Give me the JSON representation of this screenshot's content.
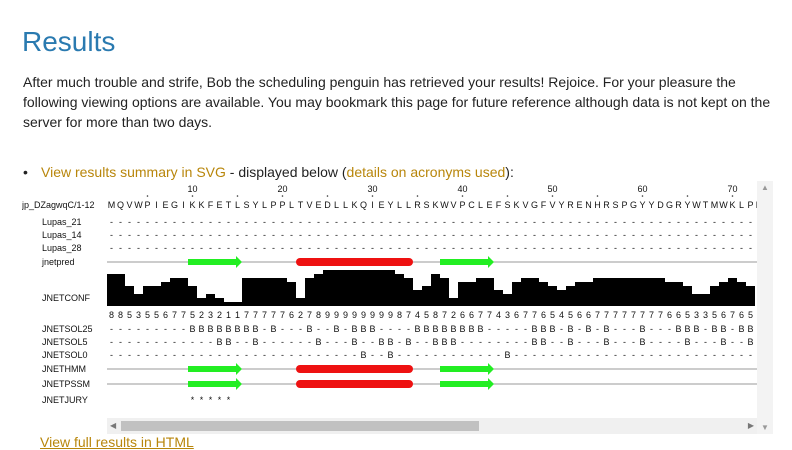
{
  "page": {
    "title": "Results",
    "intro": "After much trouble and strife, Bob the scheduling penguin has retrieved your results! Rejoice. For your pleasure the following viewing options are available. You may bookmark this page for future reference although data is not kept on the server for more than two days.",
    "summary_link": "View results summary in SVG",
    "summary_mid": " - displayed below (",
    "acronyms_link": "details on acronyms used",
    "summary_end": "):",
    "next_link": "View full results in HTML"
  },
  "viewer": {
    "ruler_ticks": [
      "10",
      "20",
      "30",
      "40",
      "50",
      "60",
      "70"
    ],
    "query_label": "jp_DZagwqC/1-12",
    "sequence": "MQVWPIEGIKKFETLSYLPPLTVEDLLKQIEYLLRSKWVPCLEFSKVGFVYRENHRSPGYYDGRYWTMWKLPM",
    "rows": [
      {
        "label": "Lupas_21",
        "kind": "dots"
      },
      {
        "label": "Lupas_14",
        "kind": "dots"
      },
      {
        "label": "Lupas_28",
        "kind": "dots"
      },
      {
        "label": "jnetpred",
        "kind": "ss"
      },
      {
        "label": "JNETCONF",
        "kind": "conf"
      },
      {
        "label": "JNETSOL25",
        "kind": "text"
      },
      {
        "label": "JNETSOL5",
        "kind": "text"
      },
      {
        "label": "JNETSOL0",
        "kind": "text"
      },
      {
        "label": "JNETHMM",
        "kind": "ss"
      },
      {
        "label": "JNETPSSM",
        "kind": "ss"
      },
      {
        "label": "JNETJURY",
        "kind": "jury"
      }
    ],
    "conf_digits": "885355677523211777776278999999998745872667743677654566777777776653356765",
    "sol25": "---------BBBBBBBB-B---B--B-BBB----BBBBBBBB-----BBB-B-B-B---B---BBB-BB-BBI",
    "sol5": "------------BB--B------B---B--BB-B--BBB--------BB--B---B---B----B---B--B",
    "sol0": "----------------------------B--B------------B---------------------------",
    "jury": "*****",
    "segments": [
      {
        "type": "strand",
        "start": 10,
        "end": 15,
        "color": "#22ee22"
      },
      {
        "type": "helix",
        "start": 22,
        "end": 34,
        "color": "#ee1111"
      },
      {
        "type": "strand",
        "start": 38,
        "end": 43,
        "color": "#22ee22"
      }
    ],
    "conf_values": [
      8,
      8,
      5,
      3,
      5,
      5,
      6,
      7,
      7,
      5,
      2,
      3,
      2,
      1,
      1,
      7,
      7,
      7,
      7,
      7,
      6,
      2,
      7,
      8,
      9,
      9,
      9,
      9,
      9,
      9,
      9,
      9,
      8,
      7,
      4,
      5,
      8,
      7,
      2,
      6,
      6,
      7,
      7,
      4,
      3,
      6,
      7,
      7,
      6,
      5,
      4,
      5,
      6,
      6,
      7,
      7,
      7,
      7,
      7,
      7,
      7,
      7,
      6,
      6,
      5,
      3,
      3,
      5,
      6,
      7,
      6,
      5
    ]
  }
}
